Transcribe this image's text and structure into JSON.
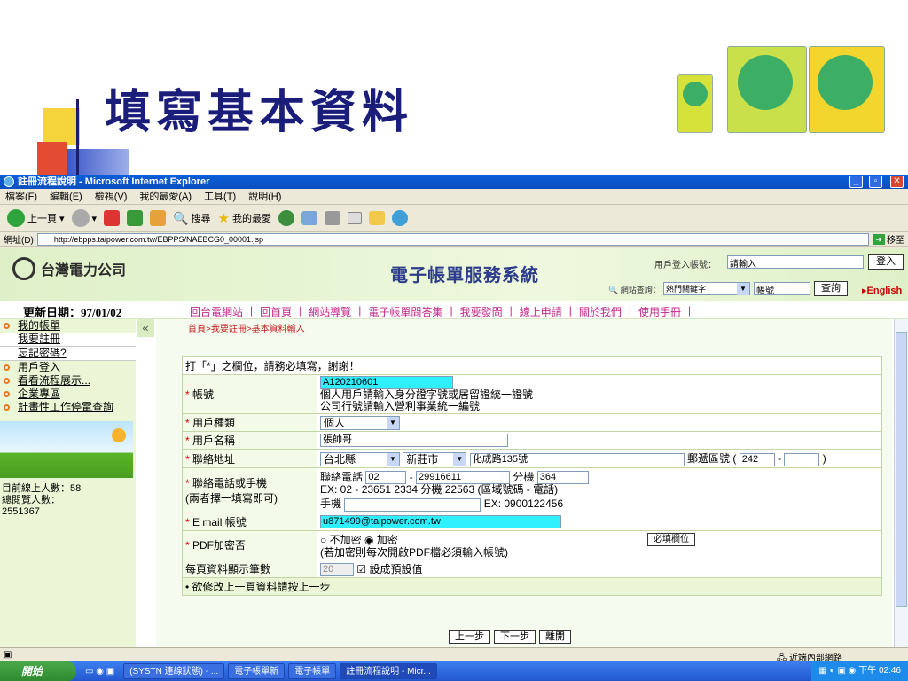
{
  "slide": {
    "title": "填寫基本資料"
  },
  "window": {
    "title": "註冊流程說明 - Microsoft Internet Explorer",
    "menu": [
      "檔案(F)",
      "編輯(E)",
      "檢視(V)",
      "我的最愛(A)",
      "工具(T)",
      "說明(H)"
    ],
    "toolbar": {
      "back": "上一頁",
      "search": "搜尋",
      "favorites": "我的最愛"
    },
    "address_label": "網址(D)",
    "address_value": "http://ebpps.taipower.com.tw/EBPPS/NAEBCG0_00001.jsp",
    "go_label": "移至"
  },
  "site": {
    "logo_text": "台灣電力公司",
    "system_title": "電子帳單服務系統",
    "login_label": "用戶登入帳號：",
    "login_value": "請輸入",
    "login_button": "登入",
    "search_label": "網站查詢：",
    "search_select": "熱門關鍵字",
    "search_value": "帳號",
    "search_button": "查詢",
    "english": "English",
    "update_date": "更新日期：97/01/02",
    "nav": [
      "回台電網站",
      "|",
      "回首頁",
      "|",
      "網站導覽",
      "|",
      "電子帳單問答集",
      "|",
      "我要發問",
      "|",
      "線上申請",
      "|",
      "關於我們",
      "|",
      "使用手冊",
      "|"
    ]
  },
  "sidebar": {
    "items": [
      "我的帳單",
      "我要註冊",
      "忘記密碼?",
      "用戶登入",
      "看看流程展示...",
      "企業專區",
      "計畫性工作停電查詢"
    ],
    "online_label": "目前線上人數：58",
    "visitors_label": "總閱覽人數：",
    "visitors_value": "2551367"
  },
  "form": {
    "breadcrumb": "首頁>我要註冊>基本資料輸入",
    "intro": "打「*」之欄位，請務必填寫，謝謝！",
    "account_label": "帳號",
    "account_value": "A120210601",
    "account_note1": "個人用戶請輸入身分證字號或居留證統一證號",
    "account_note2": "公司行號請輸入營利事業統一編號",
    "type_label": "用戶種類",
    "type_value": "個人",
    "name_label": "用戶名稱",
    "name_value": "張帥哥",
    "address_label": "聯絡地址",
    "county": "台北縣",
    "city": "新莊市",
    "street": "化成路135號",
    "zip_label": "郵遞區號 (",
    "zip_value": "242",
    "zip_dash": "-",
    "zip_close": ")",
    "phone_label1": "聯絡電話或手機",
    "phone_label2": "(兩者擇一填寫即可)",
    "tel_label": "聯絡電話",
    "tel_area": "02",
    "tel_dash": "-",
    "tel_number": "29916611",
    "ext_label": "分機",
    "ext_value": "364",
    "tel_example": "EX: 02 - 23651 2334 分機 22563 (區域號碼 - 電話)",
    "mobile_label": "手機",
    "mobile_example": "EX: 0900122456",
    "email_label": "E mail 帳號",
    "email_value": "u871499@taipower.com.tw",
    "pdf_label": "PDF加密否",
    "pdf_option_no": "不加密",
    "pdf_option_yes": "加密",
    "pdf_note": "(若加密則每次開啟PDF檔必須輸入帳號)",
    "required_button": "必填欄位",
    "page_count_label": "每頁資料顯示筆數",
    "page_count_value": "20",
    "default_label": "設成預設值",
    "hint": "• 欲修改上一頁資料請按上一步",
    "prev_button": "上一步",
    "next_button": "下一步",
    "leave_button": "離開"
  },
  "status": {
    "zone": "近端內部網路"
  },
  "taskbar": {
    "start": "開始",
    "tasks": [
      "(SYSTN 連線狀態) - ...",
      "電子帳單新",
      "電子帳單",
      "註冊流程說明 - Micr..."
    ],
    "clock": "下午 02:46"
  }
}
